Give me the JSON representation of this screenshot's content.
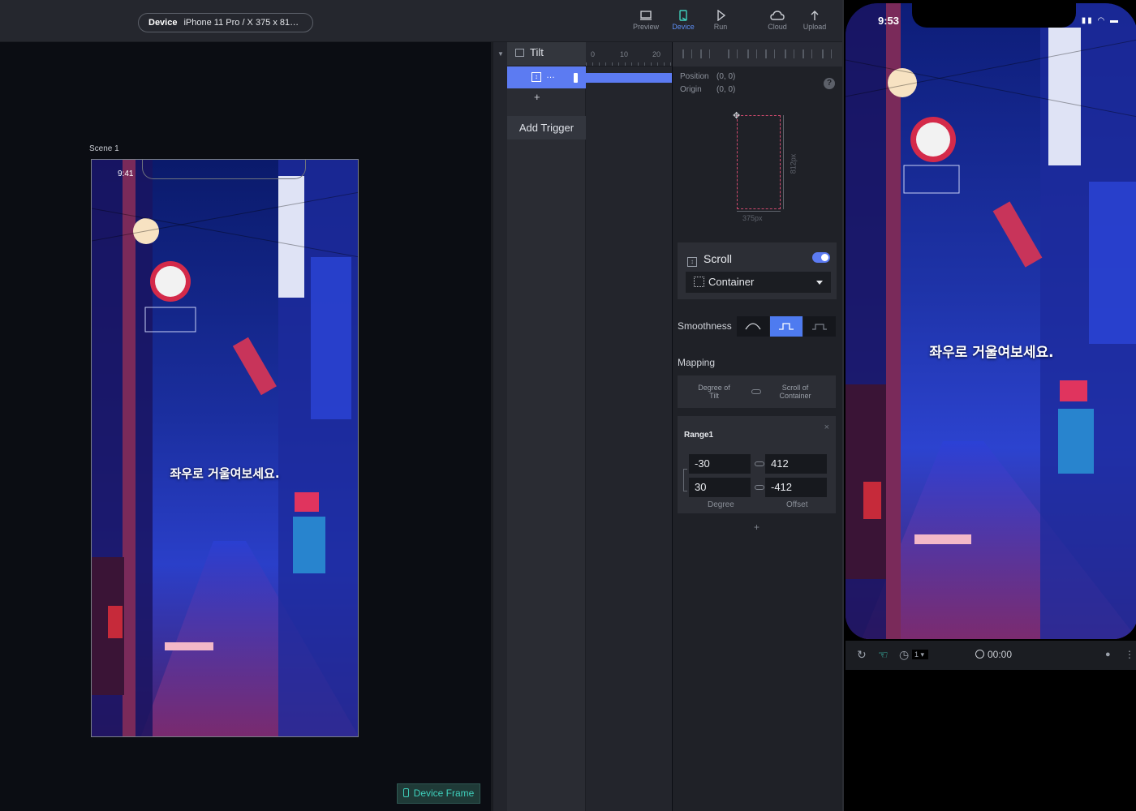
{
  "toolbar": {
    "device_label": "Device",
    "device_value": "iPhone 11 Pro / X  375 x 81…",
    "tools": [
      {
        "label": "Preview",
        "icon": "preview-icon"
      },
      {
        "label": "Device",
        "icon": "device-icon"
      },
      {
        "label": "Run",
        "icon": "run-icon"
      },
      {
        "label": "Cloud",
        "icon": "cloud-icon"
      },
      {
        "label": "Upload",
        "icon": "upload-icon"
      }
    ]
  },
  "canvas": {
    "scene_label": "Scene 1",
    "scene_status_time": "9:41",
    "overlay_text": "좌우로 거울여보세요.",
    "device_frame_button": "Device Frame"
  },
  "layers": {
    "tilt_label": "Tilt",
    "selected_layer_name": "…",
    "add_row": "+",
    "add_trigger": "Add Trigger",
    "ruler": [
      "0",
      "10",
      "20"
    ]
  },
  "props": {
    "position_label": "Position",
    "position_value": "(0, 0)",
    "origin_label": "Origin",
    "origin_value": "(0, 0)",
    "help": "?",
    "width_dim": "375px",
    "height_dim": "812px",
    "scroll_title": "Scroll",
    "scroll_enabled": true,
    "container_value": "Container",
    "smoothness_label": "Smoothness",
    "smoothness_selected": 1,
    "mapping_label": "Mapping",
    "mapping_left": "Degree of Tilt",
    "mapping_right": "Scroll of Container",
    "range": {
      "name": "Range1",
      "close": "×",
      "degree_from": "-30",
      "degree_to": "30",
      "offset_from": "412",
      "offset_to": "-412",
      "degree_caption": "Degree",
      "offset_caption": "Offset"
    },
    "add_range": "+"
  },
  "preview": {
    "status_time": "9:53",
    "overlay_text": "좌우로 거울여보세요.",
    "speed_value": "1",
    "timer": "00:00"
  },
  "colors": {
    "accent": "#5c7bf2",
    "teal": "#3fd1bd",
    "panel": "#1f2127"
  }
}
